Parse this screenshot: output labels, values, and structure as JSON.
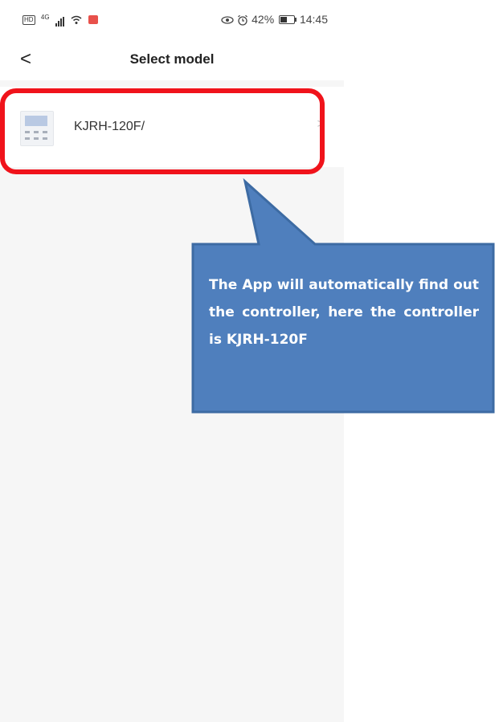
{
  "status_bar": {
    "hd": "HD",
    "network": "4G",
    "battery": "42%",
    "time": "14:45",
    "icons": [
      "hd-badge-icon",
      "signal-icon",
      "wifi-icon",
      "notification-icon",
      "eye-icon",
      "alarm-icon",
      "battery-icon"
    ]
  },
  "header": {
    "back_icon": "chevron-left-icon",
    "back_glyph": "<",
    "title": "Select model"
  },
  "models": [
    {
      "label": "KJRH-120F/",
      "icon": "controller-thumbnail",
      "chevron": ">"
    }
  ],
  "annotation": {
    "text": "The App will automatically find out the controller, here the controller is KJRH-120F",
    "highlight_color": "#f0131b",
    "callout_color": "#4f7fbd"
  }
}
